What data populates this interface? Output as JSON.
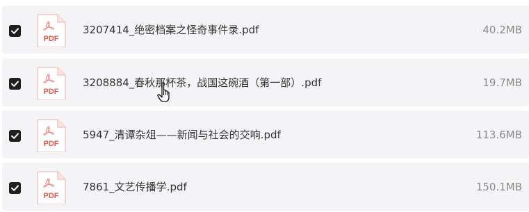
{
  "files": [
    {
      "name": "3207414_绝密档案之怪奇事件录.pdf",
      "size": "40.2MB",
      "checked": true,
      "icon": "pdf-icon",
      "icon_label": "PDF"
    },
    {
      "name": "3208884_春秋那杯茶，战国这碗酒（第一部）.pdf",
      "size": "19.7MB",
      "checked": true,
      "icon": "pdf-icon",
      "icon_label": "PDF"
    },
    {
      "name": "5947_清谭杂俎——新闻与社会的交响.pdf",
      "size": "113.6MB",
      "checked": true,
      "icon": "pdf-icon",
      "icon_label": "PDF"
    },
    {
      "name": "7861_文艺传播学.pdf",
      "size": "150.1MB",
      "checked": true,
      "icon": "pdf-icon",
      "icon_label": "PDF"
    }
  ],
  "colors": {
    "row_background": "#f4f4f7",
    "checkbox": "#1f1f1f",
    "pdf_red": "#e55a4e",
    "size_text": "#8a8a8a"
  },
  "cursor": "hand-pointer-icon"
}
